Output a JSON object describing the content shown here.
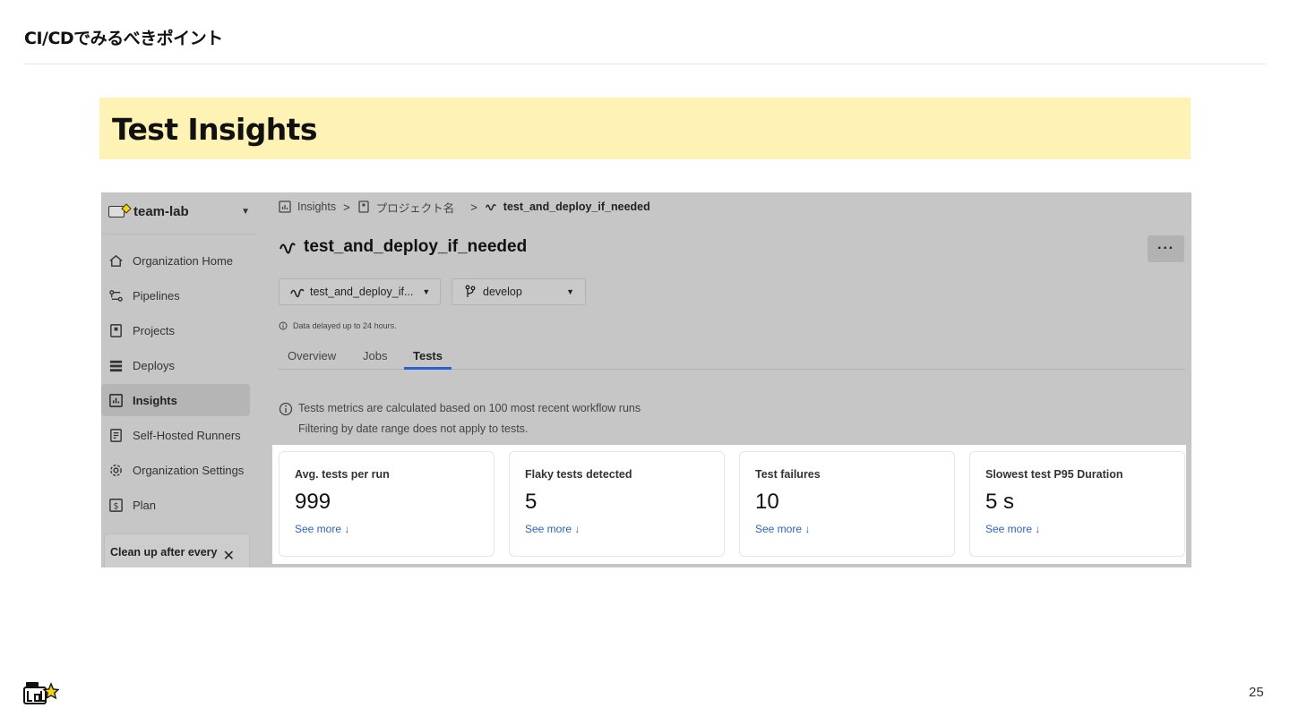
{
  "slide": {
    "header": "CI/CDでみるべきポイント",
    "title": "Test Insights",
    "page_number": "25",
    "logo_name": "teamlab-logo"
  },
  "sidebar": {
    "org_name": "team-lab",
    "items": [
      {
        "label": "Organization Home",
        "icon": "home-icon",
        "active": false
      },
      {
        "label": "Pipelines",
        "icon": "pipelines-icon",
        "active": false
      },
      {
        "label": "Projects",
        "icon": "project-icon",
        "active": false
      },
      {
        "label": "Deploys",
        "icon": "deploys-icon",
        "active": false
      },
      {
        "label": "Insights",
        "icon": "insights-icon",
        "active": true
      },
      {
        "label": "Self-Hosted Runners",
        "icon": "runner-icon",
        "active": false
      },
      {
        "label": "Organization Settings",
        "icon": "gear-icon",
        "active": false
      },
      {
        "label": "Plan",
        "icon": "dollar-icon",
        "active": false
      }
    ],
    "promo_text": "Clean up after every"
  },
  "breadcrumb": {
    "items": [
      "Insights",
      "プロジェクト名",
      "test_and_deploy_if_needed"
    ]
  },
  "workflow": {
    "title": "test_and_deploy_if_needed",
    "more_label": "···",
    "workflow_select": "test_and_deploy_if...",
    "branch_select": "develop",
    "delay_note": "Data delayed up to 24 hours."
  },
  "tabs": [
    "Overview",
    "Jobs",
    "Tests"
  ],
  "active_tab": "Tests",
  "notice": {
    "line1": "Tests metrics are calculated based on 100 most recent workflow runs",
    "line2": "Filtering by date range does not apply to tests."
  },
  "cards": [
    {
      "label": "Avg. tests per run",
      "value": "999",
      "link": "See more ↓"
    },
    {
      "label": "Flaky tests detected",
      "value": "5",
      "link": "See more ↓"
    },
    {
      "label": "Test failures",
      "value": "10",
      "link": "See more ↓"
    },
    {
      "label": "Slowest test P95 Duration",
      "value": "5 s",
      "link": "See more ↓"
    }
  ],
  "colors": {
    "title_band": "#fff2b5",
    "screenshot_overlay": "#c6c6c6",
    "active_tab_underline": "#2b5fd9",
    "link": "#2b5fd9"
  }
}
